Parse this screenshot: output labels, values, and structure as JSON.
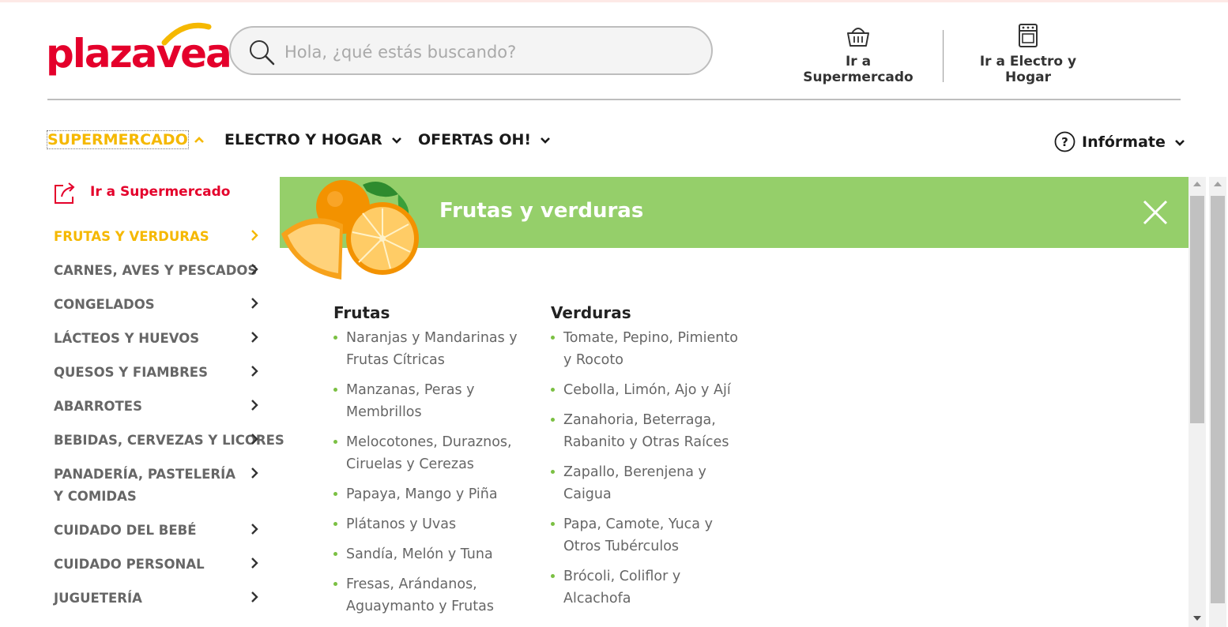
{
  "brand": {
    "logo_text": "plazavea",
    "primary_color": "#e4002b",
    "accent_color": "#f5b800"
  },
  "search": {
    "placeholder": "Hola, ¿qué estás buscando?"
  },
  "header_links": [
    {
      "label": "Ir a Supermercado",
      "icon": "basket-icon"
    },
    {
      "label": "Ir a Electro y Hogar",
      "icon": "stove-icon"
    }
  ],
  "nav": {
    "items": [
      {
        "label": "SUPERMERCADO",
        "state": "active"
      },
      {
        "label": "ELECTRO Y HOGAR"
      },
      {
        "label": "OFERTAS OH!"
      }
    ],
    "info_label": "Infórmate"
  },
  "sidebar": {
    "top_link": "Ir a Supermercado",
    "categories": [
      "FRUTAS Y VERDURAS",
      "CARNES, AVES Y PESCADOS",
      "CONGELADOS",
      "LÁCTEOS Y HUEVOS",
      "QUESOS Y FIAMBRES",
      "ABARROTES",
      "BEBIDAS, CERVEZAS Y LICORES",
      "PANADERÍA, PASTELERÍA Y COMIDAS",
      "CUIDADO DEL BEBÉ",
      "CUIDADO PERSONAL",
      "JUGUETERÍA"
    ],
    "active_index": 0
  },
  "panel": {
    "title": "Frutas y verduras",
    "banner_color": "#95cf6a",
    "columns": [
      {
        "heading": "Frutas",
        "items": [
          "Naranjas y Mandarinas y Frutas Cítricas",
          "Manzanas, Peras y Membrillos",
          "Melocotones, Duraznos, Ciruelas y Cerezas",
          "Papaya, Mango y Piña",
          "Plátanos y Uvas",
          "Sandía, Melón y Tuna",
          "Fresas, Arándanos, Aguaymanto y Frutas"
        ]
      },
      {
        "heading": "Verduras",
        "items": [
          "Tomate, Pepino, Pimiento y Rocoto",
          "Cebolla, Limón, Ajo y Ají",
          "Zanahoria, Beterraga, Rabanito y Otras Raíces",
          "Zapallo, Berenjena y Caigua",
          "Papa, Camote, Yuca y Otros Tubérculos",
          "Brócoli, Coliflor y Alcachofa"
        ]
      }
    ]
  }
}
